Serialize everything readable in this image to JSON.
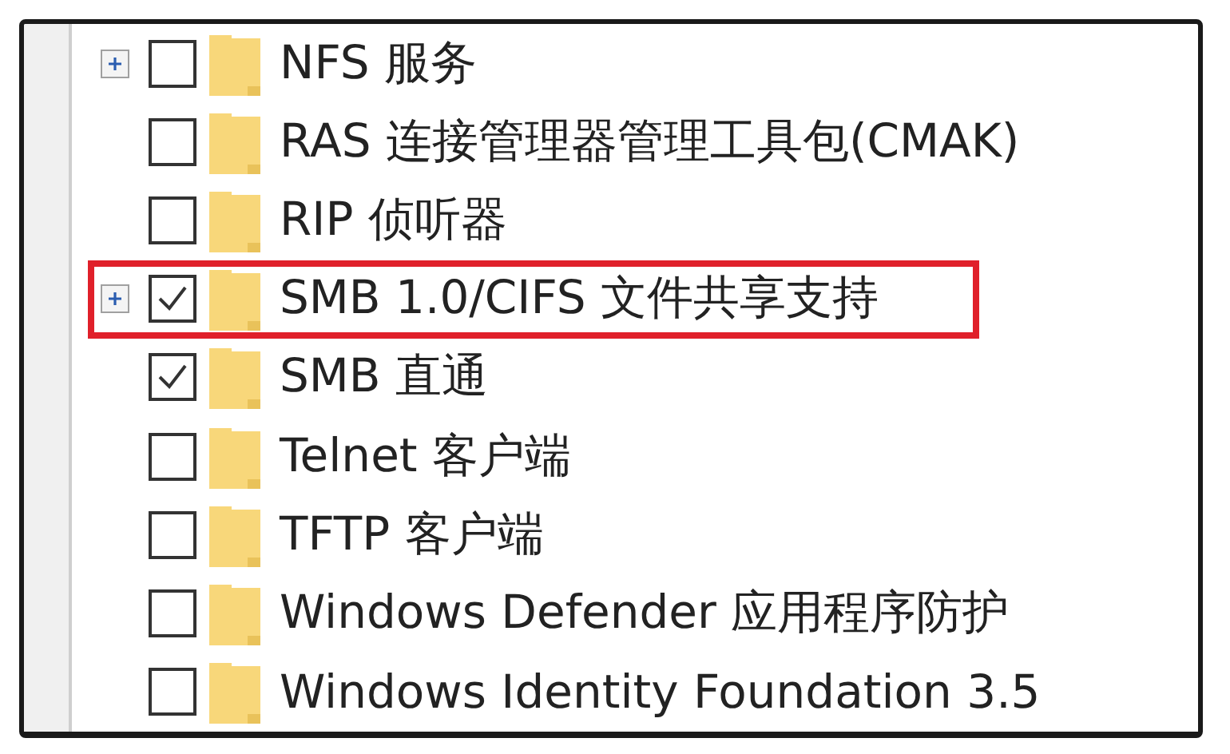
{
  "features": [
    {
      "label": "NFS 服务",
      "expandable": true,
      "checked": false,
      "highlighted": false
    },
    {
      "label": "RAS 连接管理器管理工具包(CMAK)",
      "expandable": false,
      "checked": false,
      "highlighted": false
    },
    {
      "label": "RIP 侦听器",
      "expandable": false,
      "checked": false,
      "highlighted": false
    },
    {
      "label": "SMB 1.0/CIFS 文件共享支持",
      "expandable": true,
      "checked": true,
      "highlighted": true
    },
    {
      "label": "SMB 直通",
      "expandable": false,
      "checked": true,
      "highlighted": false
    },
    {
      "label": "Telnet 客户端",
      "expandable": false,
      "checked": false,
      "highlighted": false
    },
    {
      "label": "TFTP 客户端",
      "expandable": false,
      "checked": false,
      "highlighted": false
    },
    {
      "label": "Windows Defender 应用程序防护",
      "expandable": false,
      "checked": false,
      "highlighted": false
    },
    {
      "label": "Windows Identity Foundation 3.5",
      "expandable": false,
      "checked": false,
      "highlighted": false
    }
  ]
}
